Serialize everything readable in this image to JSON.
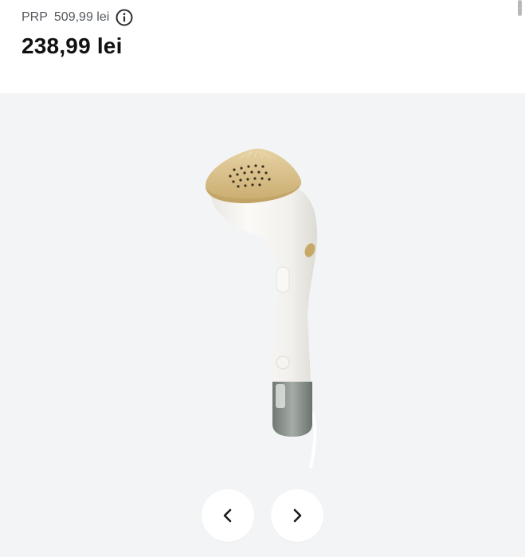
{
  "pricing": {
    "prp_label": "PRP",
    "prp_value": "509,99 lei",
    "sale_price": "238,99 lei"
  },
  "icons": {
    "info": "info-circle-icon",
    "prev": "chevron-left-icon",
    "next": "chevron-right-icon"
  },
  "colors": {
    "gallery_background": "#f3f4f6",
    "device_body": "#f4f3ef",
    "device_head": "#d8bf8a",
    "water_tank": "#8a938e"
  }
}
